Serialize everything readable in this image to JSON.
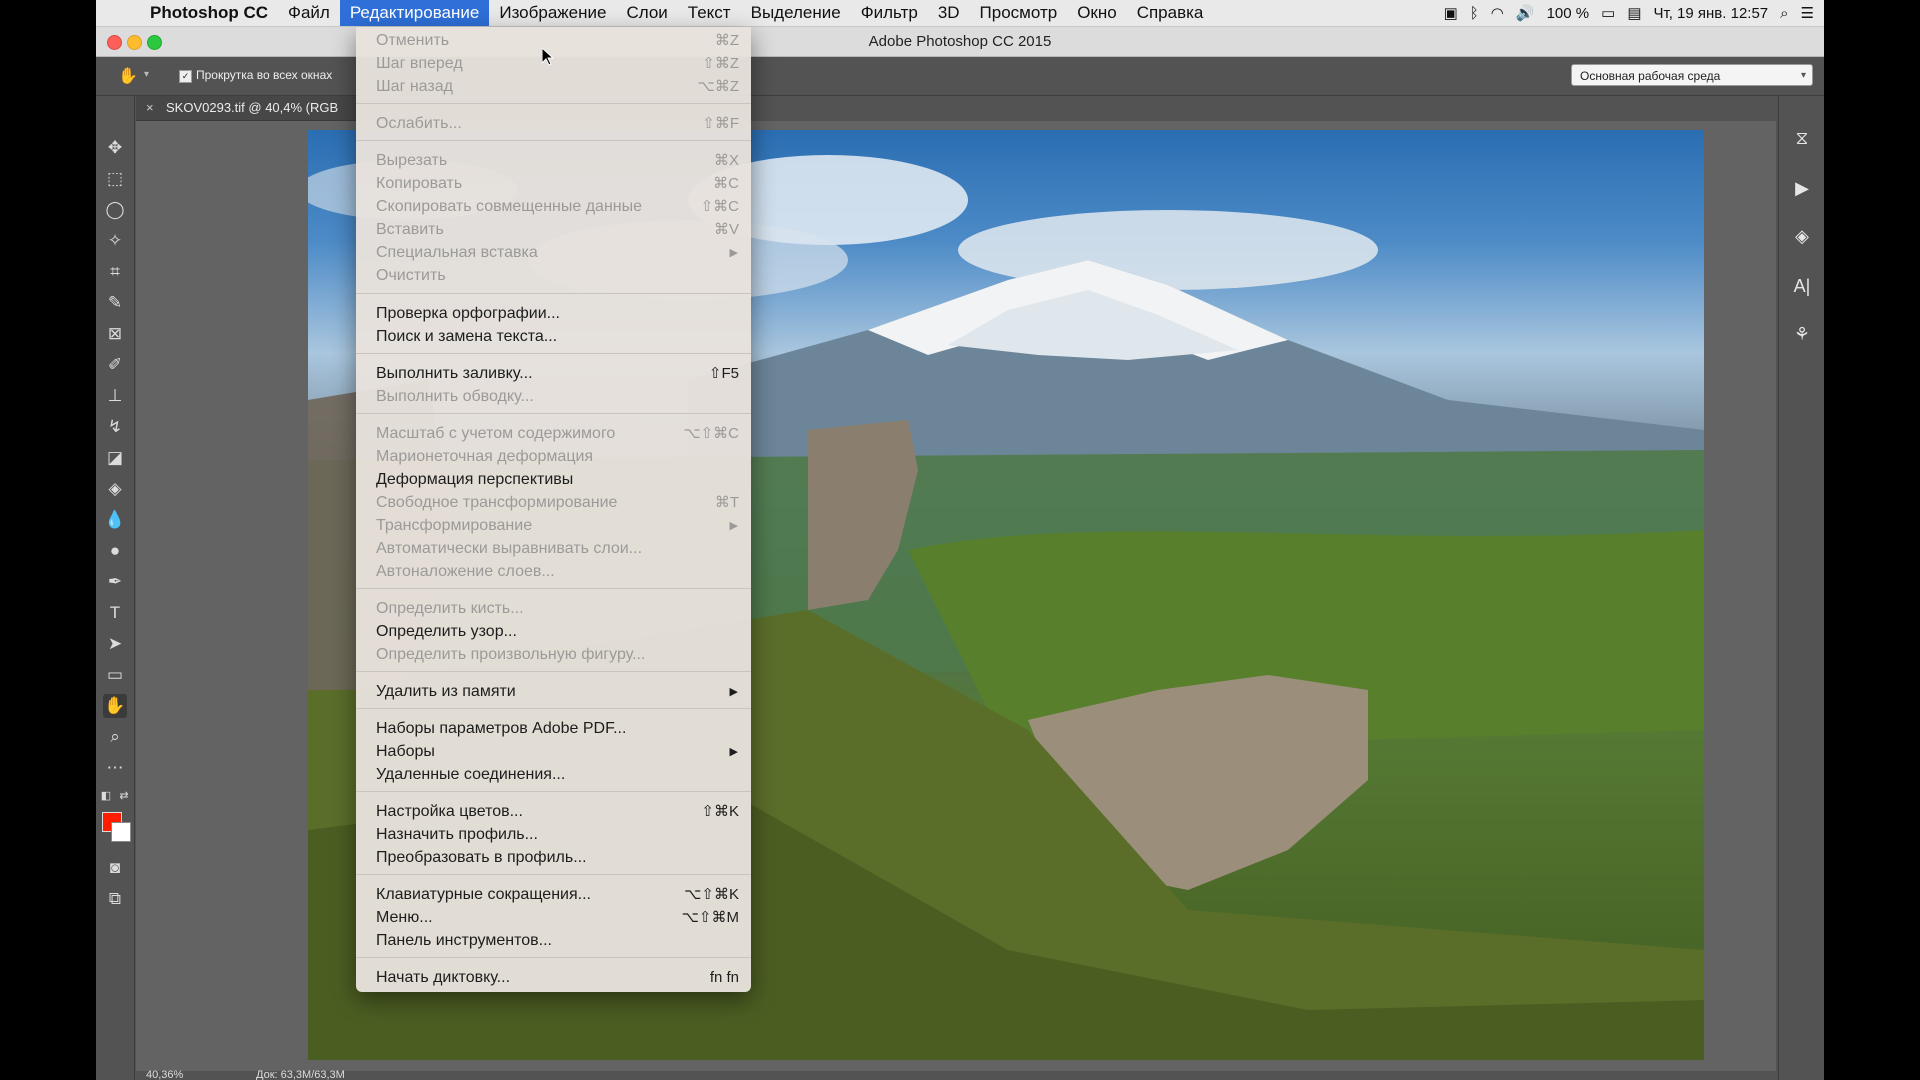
{
  "menubar": {
    "app_name": "Photoshop CC",
    "items": [
      "Файл",
      "Редактирование",
      "Изображение",
      "Слои",
      "Текст",
      "Выделение",
      "Фильтр",
      "3D",
      "Просмотр",
      "Окно",
      "Справка"
    ],
    "active": "Редактирование",
    "battery": "100 %",
    "datetime": "Чт, 19 янв.  12:57"
  },
  "window": {
    "title": "Adobe Photoshop CC 2015"
  },
  "options_bar": {
    "scroll_all_label": "Прокрутка во всех окнах",
    "scroll_all_checked": true,
    "workspace": "Основная рабочая среда"
  },
  "document": {
    "tab_name": "SKOV0293.tif @ 40,4% (RGB"
  },
  "status": {
    "zoom": "40,36%",
    "doc_size": "Док: 63,3M/63,3M"
  },
  "colors": {
    "foreground": "#ff1d00",
    "background": "#ffffff",
    "menu_highlight": "#2e6fd8"
  },
  "edit_menu": {
    "items": [
      {
        "label": "Отменить",
        "shortcut": "⌘Z",
        "enabled": false
      },
      {
        "label": "Шаг вперед",
        "shortcut": "⇧⌘Z",
        "enabled": false
      },
      {
        "label": "Шаг назад",
        "shortcut": "⌥⌘Z",
        "enabled": false
      },
      {
        "label": "Ослабить...",
        "shortcut": "⇧⌘F",
        "enabled": false
      },
      {
        "label": "Вырезать",
        "shortcut": "⌘X",
        "enabled": false
      },
      {
        "label": "Копировать",
        "shortcut": "⌘C",
        "enabled": false
      },
      {
        "label": "Скопировать совмещенные данные",
        "shortcut": "⇧⌘C",
        "enabled": false
      },
      {
        "label": "Вставить",
        "shortcut": "⌘V",
        "enabled": false
      },
      {
        "label": "Специальная вставка",
        "submenu": true,
        "enabled": false
      },
      {
        "label": "Очистить",
        "enabled": false
      },
      {
        "label": "Проверка орфографии...",
        "enabled": true
      },
      {
        "label": "Поиск и замена текста...",
        "enabled": true
      },
      {
        "label": "Выполнить заливку...",
        "shortcut": "⇧F5",
        "enabled": true
      },
      {
        "label": "Выполнить обводку...",
        "enabled": false
      },
      {
        "label": "Масштаб с учетом содержимого",
        "shortcut": "⌥⇧⌘C",
        "enabled": false
      },
      {
        "label": "Марионеточная деформация",
        "enabled": false
      },
      {
        "label": "Деформация перспективы",
        "enabled": true
      },
      {
        "label": "Свободное трансформирование",
        "shortcut": "⌘T",
        "enabled": false
      },
      {
        "label": "Трансформирование",
        "submenu": true,
        "enabled": false
      },
      {
        "label": "Автоматически выравнивать слои...",
        "enabled": false
      },
      {
        "label": "Автоналожение слоев...",
        "enabled": false
      },
      {
        "label": "Определить кисть...",
        "enabled": false
      },
      {
        "label": "Определить узор...",
        "enabled": true
      },
      {
        "label": "Определить произвольную фигуру...",
        "enabled": false
      },
      {
        "label": "Удалить из памяти",
        "submenu": true,
        "enabled": true
      },
      {
        "label": "Наборы параметров Adobe PDF...",
        "enabled": true
      },
      {
        "label": "Наборы",
        "submenu": true,
        "enabled": true
      },
      {
        "label": "Удаленные соединения...",
        "enabled": true
      },
      {
        "label": "Настройка цветов...",
        "shortcut": "⇧⌘K",
        "enabled": true
      },
      {
        "label": "Назначить профиль...",
        "enabled": true
      },
      {
        "label": "Преобразовать в профиль...",
        "enabled": true
      },
      {
        "label": "Клавиатурные сокращения...",
        "shortcut": "⌥⇧⌘K",
        "enabled": true
      },
      {
        "label": "Меню...",
        "shortcut": "⌥⇧⌘M",
        "enabled": true
      },
      {
        "label": "Панель инструментов...",
        "enabled": true
      },
      {
        "label": "Начать диктовку...",
        "shortcut": "fn fn",
        "enabled": true
      }
    ]
  },
  "tools": [
    "move-tool",
    "marquee-tool",
    "lasso-tool",
    "magic-wand-tool",
    "crop-tool",
    "eyedropper-tool",
    "healing-brush-tool",
    "brush-tool",
    "clone-stamp-tool",
    "history-brush-tool",
    "eraser-tool",
    "paint-bucket-tool",
    "blur-tool",
    "dodge-tool",
    "pen-tool",
    "type-tool",
    "path-selection-tool",
    "rectangle-tool",
    "hand-tool",
    "zoom-tool",
    "more-tools"
  ],
  "selected_tool": "hand-tool",
  "right_panel_icons": [
    "history-panel-icon",
    "actions-panel-icon",
    "layers-panel-icon",
    "character-panel-icon",
    "brush-panel-icon"
  ]
}
